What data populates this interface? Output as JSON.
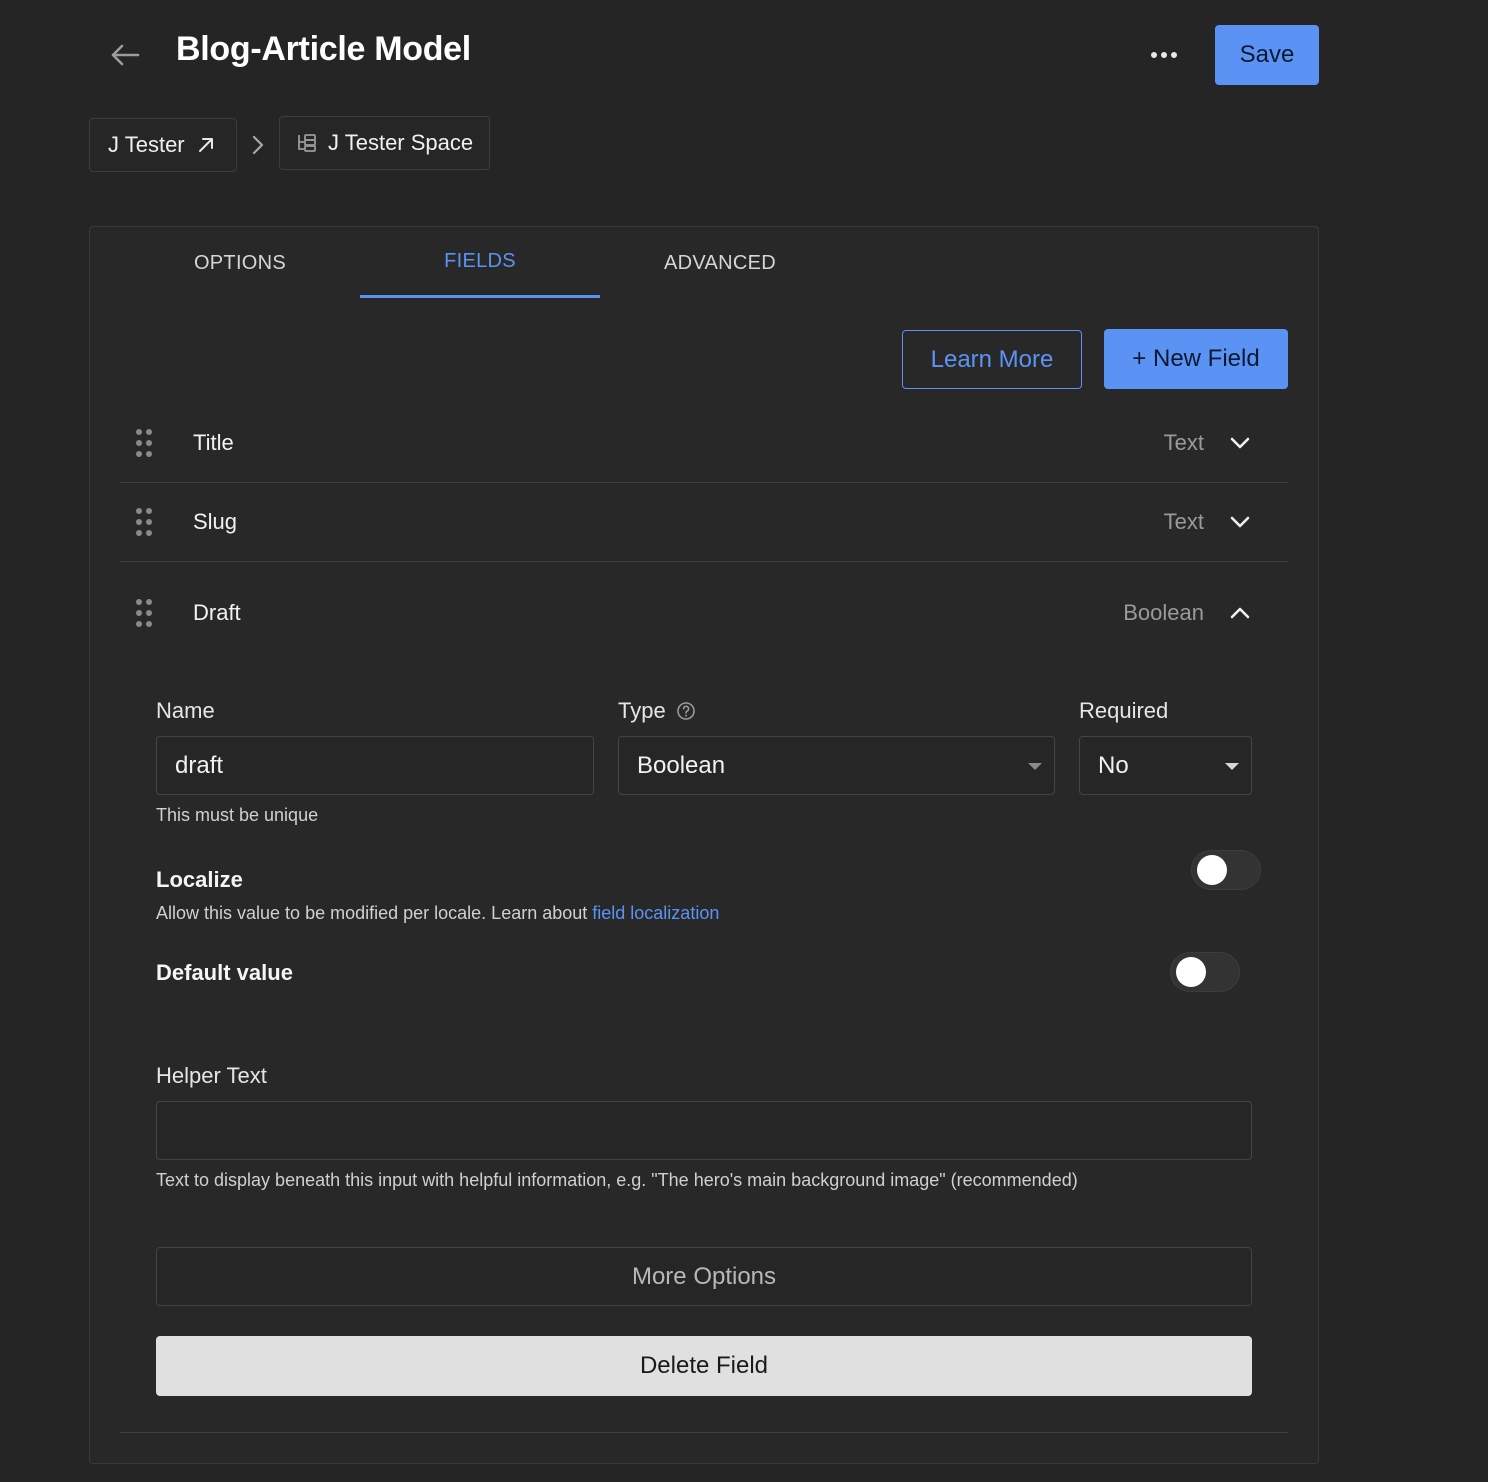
{
  "header": {
    "title": "Blog-Article Model",
    "save_label": "Save"
  },
  "breadcrumb": {
    "org": "J Tester",
    "space": "J Tester Space"
  },
  "tabs": [
    {
      "label": "OPTIONS",
      "active": false
    },
    {
      "label": "FIELDS",
      "active": true
    },
    {
      "label": "ADVANCED",
      "active": false
    }
  ],
  "actions": {
    "learn_more": "Learn More",
    "new_field": "+ New Field"
  },
  "fields": [
    {
      "name": "Title",
      "type": "Text",
      "expanded": false
    },
    {
      "name": "Slug",
      "type": "Text",
      "expanded": false
    },
    {
      "name": "Draft",
      "type": "Boolean",
      "expanded": true
    }
  ],
  "editor": {
    "name_label": "Name",
    "name_value": "draft",
    "name_hint": "This must be unique",
    "type_label": "Type",
    "type_value": "Boolean",
    "required_label": "Required",
    "required_value": "No",
    "localize_label": "Localize",
    "localize_desc": "Allow this value to be modified per locale. Learn about ",
    "localize_link": "field localization",
    "localize_on": false,
    "default_label": "Default value",
    "default_on": false,
    "helper_label": "Helper Text",
    "helper_value": "",
    "helper_hint": "Text to display beneath this input with helpful information, e.g. \"The hero's main background image\" (recommended)",
    "more_options": "More Options",
    "delete_field": "Delete Field"
  },
  "colors": {
    "accent": "#5b93f5",
    "background": "#252525"
  }
}
